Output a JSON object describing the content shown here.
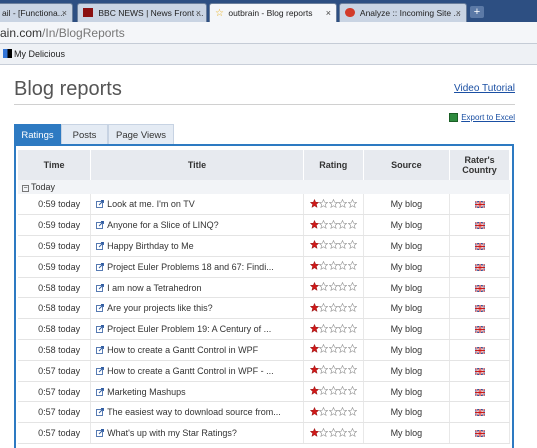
{
  "browser": {
    "tabs": [
      {
        "label": "ail - [Functiona...",
        "active": false
      },
      {
        "label": "BBC NEWS | News Front ...",
        "active": false
      },
      {
        "label": "outbrain - Blog reports",
        "active": true
      },
      {
        "label": "Analyze :: Incoming Site ...",
        "active": false
      }
    ],
    "url_host": "ain.com",
    "url_path": "/In/BlogReports",
    "bookmark": "My Delicious"
  },
  "page": {
    "title": "Blog reports",
    "video_tutorial": "Video Tutorial",
    "export": "Export to Excel",
    "tabs": [
      "Ratings",
      "Posts",
      "Page Views"
    ],
    "active_tab": "Ratings"
  },
  "grid": {
    "headers": {
      "time": "Time",
      "title": "Title",
      "rating": "Rating",
      "source": "Source",
      "country": "Rater's Country"
    },
    "group_label": "Today",
    "rows": [
      {
        "time": "0:59 today",
        "title": "Look at me. I'm on TV",
        "rating": 1,
        "source": "My blog"
      },
      {
        "time": "0:59 today",
        "title": "Anyone for a Slice of LINQ?",
        "rating": 1,
        "source": "My blog"
      },
      {
        "time": "0:59 today",
        "title": "Happy Birthday to Me",
        "rating": 1,
        "source": "My blog"
      },
      {
        "time": "0:59 today",
        "title": "Project Euler Problems 18 and 67: Findi...",
        "rating": 1,
        "source": "My blog"
      },
      {
        "time": "0:58 today",
        "title": "I am now a Tetrahedron",
        "rating": 1,
        "source": "My blog"
      },
      {
        "time": "0:58 today",
        "title": "Are your projects like this?",
        "rating": 1,
        "source": "My blog"
      },
      {
        "time": "0:58 today",
        "title": "Project Euler Problem 19: A Century of ...",
        "rating": 1,
        "source": "My blog"
      },
      {
        "time": "0:58 today",
        "title": "How to create a Gantt Control in WPF",
        "rating": 1,
        "source": "My blog"
      },
      {
        "time": "0:57 today",
        "title": "How to create a Gantt Control in WPF - ...",
        "rating": 1,
        "source": "My blog"
      },
      {
        "time": "0:57 today",
        "title": "Marketing Mashups",
        "rating": 1,
        "source": "My blog"
      },
      {
        "time": "0:57 today",
        "title": "The easiest way to download source from...",
        "rating": 1,
        "source": "My blog"
      },
      {
        "time": "0:57 today",
        "title": "What's up with my Star Ratings?",
        "rating": 1,
        "source": "My blog"
      }
    ]
  }
}
